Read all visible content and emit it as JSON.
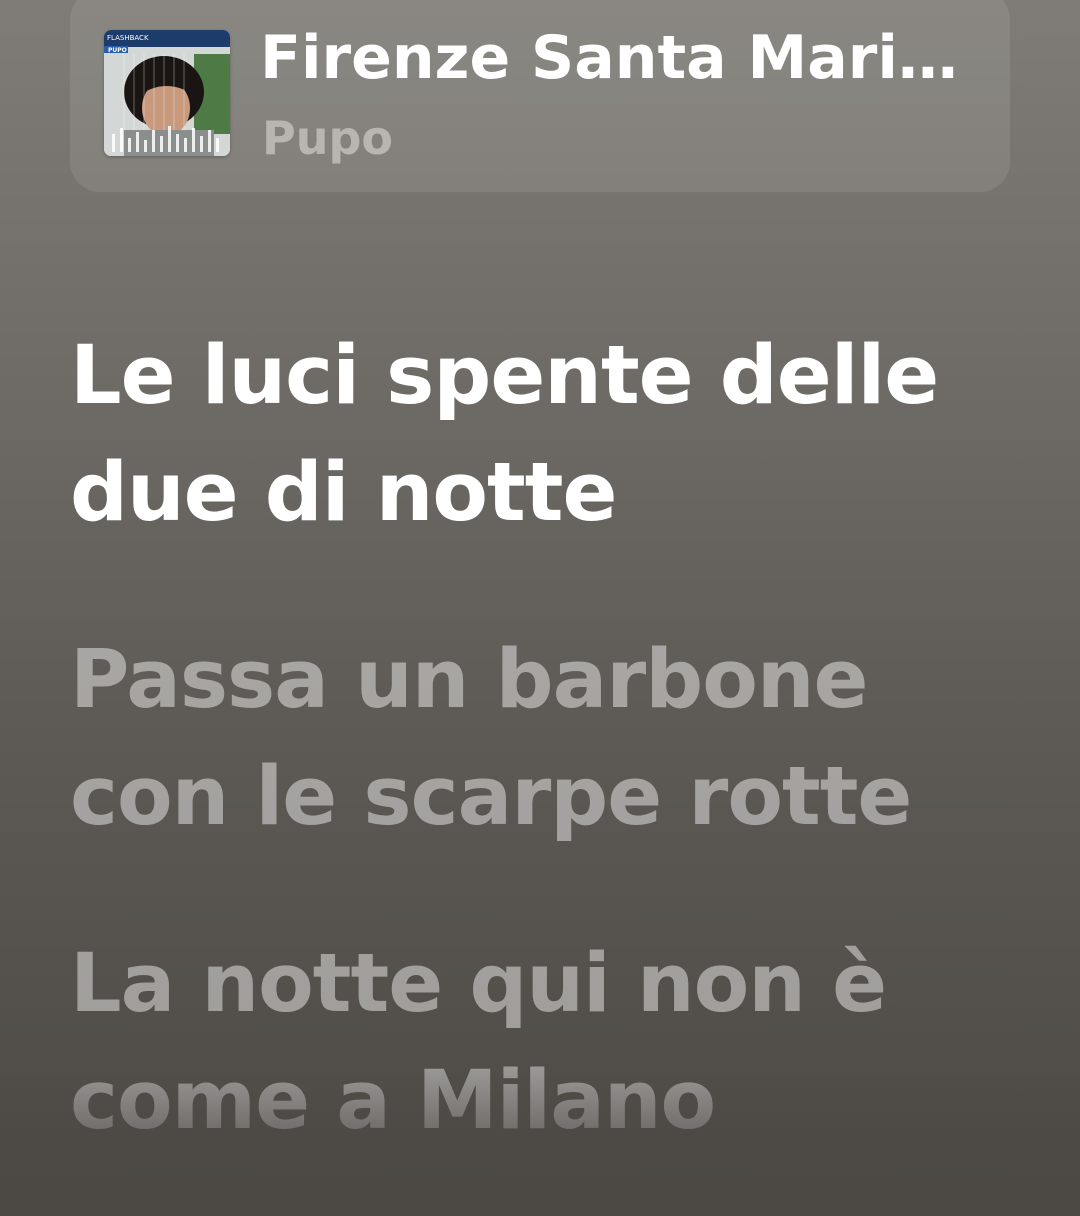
{
  "now_playing": {
    "title": "Firenze Santa Mari…",
    "artist": "Pupo",
    "artwork": {
      "banner_text": "FLASHBACK",
      "artist_label": "PUPO",
      "banner_color": "#1d3b6b"
    }
  },
  "lyrics": [
    {
      "text": "Le luci spente delle due di notte",
      "state": "active"
    },
    {
      "text": "Passa un barbone con le scarpe rotte",
      "state": "upcoming"
    },
    {
      "text": "La notte qui non è come a Milano",
      "state": "upcoming"
    }
  ],
  "colors": {
    "active_lyric": "#ffffff",
    "inactive_lyric": "rgba(255,255,255,0.45)",
    "artist_text": "#b9b6b1"
  }
}
